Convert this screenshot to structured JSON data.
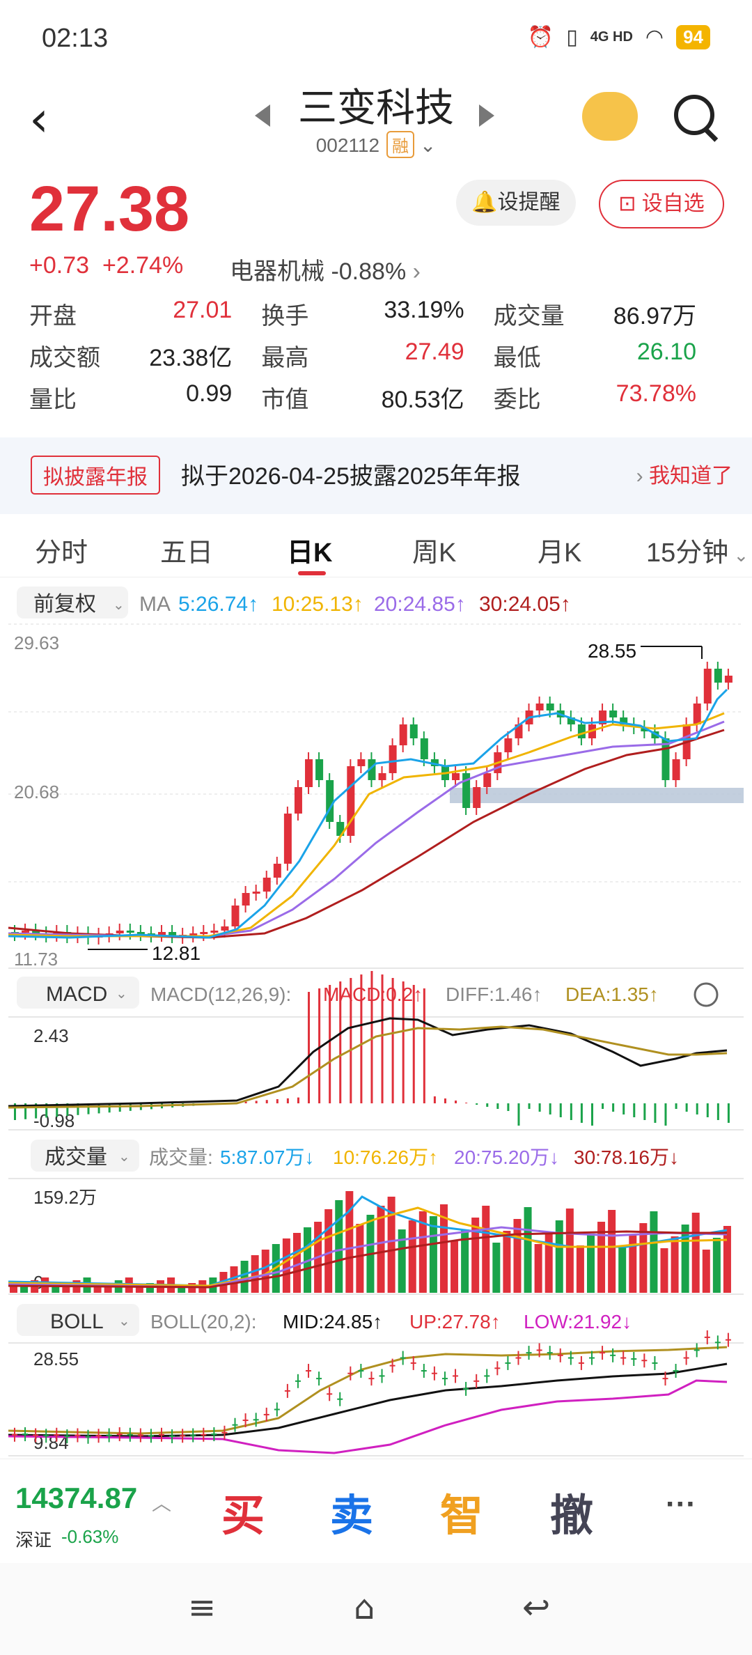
{
  "status": {
    "time": "02:13",
    "network": "4G HD",
    "battery": "94"
  },
  "header": {
    "title": "三变科技",
    "code": "002112",
    "margin_tag": "融"
  },
  "quote": {
    "price": "27.38",
    "change": "+0.73",
    "change_pct": "+2.74%",
    "sector": "电器机械",
    "sector_chg": "-0.88%",
    "remind_label": "设提醒",
    "fav_label": "设自选",
    "stats": [
      [
        {
          "label": "开盘",
          "value": "27.01",
          "color": "red"
        },
        {
          "label": "换手",
          "value": "33.19%",
          "color": "dark"
        },
        {
          "label": "成交量",
          "value": "86.97万",
          "color": "dark"
        }
      ],
      [
        {
          "label": "成交额",
          "value": "23.38亿",
          "color": "dark"
        },
        {
          "label": "最高",
          "value": "27.49",
          "color": "red"
        },
        {
          "label": "最低",
          "value": "26.10",
          "color": "green"
        }
      ],
      [
        {
          "label": "量比",
          "value": "0.99",
          "color": "dark"
        },
        {
          "label": "市值",
          "value": "80.53亿",
          "color": "dark"
        },
        {
          "label": "委比",
          "value": "73.78%",
          "color": "red"
        }
      ]
    ]
  },
  "notice": {
    "tag": "拟披露年报",
    "text": "拟于2026-04-25披露2025年年报",
    "action": "我知道了"
  },
  "tabs": [
    "分时",
    "五日",
    "日K",
    "周K",
    "月K",
    "15分钟"
  ],
  "active_tab": "日K",
  "kline": {
    "adjust": "前复权",
    "ma_label": "MA",
    "ma": [
      "5:26.74↑",
      "10:25.13↑",
      "20:24.85↑",
      "30:24.05↑"
    ],
    "y_max": "29.63",
    "y_mid": "20.68",
    "y_min": "11.73",
    "hi_label": "28.55",
    "lo_label": "12.81"
  },
  "macd": {
    "name": "MACD",
    "params": "MACD(12,26,9):",
    "macd": "MACD:0.2↑",
    "diff": "DIFF:1.46↑",
    "dea": "DEA:1.35↑",
    "y_top": "2.43",
    "y_bot": "-0.98"
  },
  "volume": {
    "name": "成交量",
    "label": "成交量:",
    "v5": "5:87.07万↓",
    "v10": "10:76.26万↑",
    "v20": "20:75.20万↓",
    "v30": "30:78.16万↓",
    "y_top": "159.2万",
    "y_bot": "0"
  },
  "boll": {
    "name": "BOLL",
    "params": "BOLL(20,2):",
    "mid": "MID:24.85↑",
    "up": "UP:27.78↑",
    "low": "LOW:21.92↓",
    "y_top": "28.55",
    "y_bot": "9.84"
  },
  "bottom": {
    "index_value": "14374.87",
    "index_name": "深证",
    "index_chg": "-0.63%",
    "buy": "买",
    "sell": "卖",
    "smart": "智",
    "cancel": "撤",
    "more": "···"
  },
  "colors": {
    "up": "#e0303a",
    "down": "#1aa34a",
    "ma5": "#1aa3e8",
    "ma10": "#f0b400",
    "ma20": "#9a6be8",
    "ma30": "#b01e1e"
  }
}
